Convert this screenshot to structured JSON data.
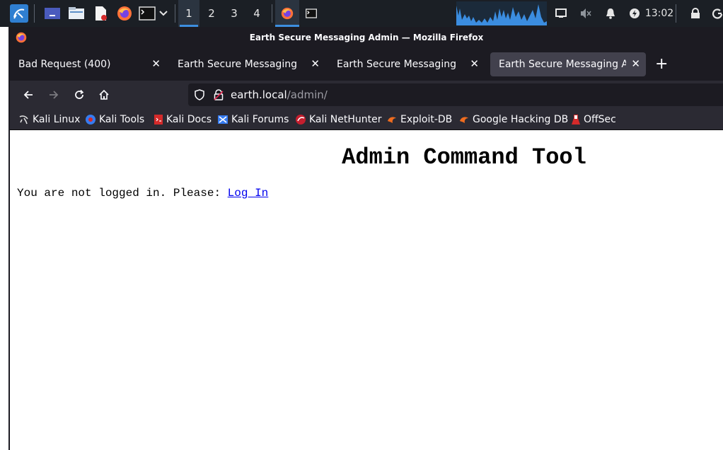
{
  "panel": {
    "workspaces": [
      "1",
      "2",
      "3",
      "4"
    ],
    "active_workspace": "1",
    "clock": "13:02",
    "icons": [
      "kali-menu-icon",
      "show-desktop-icon",
      "file-manager-icon",
      "text-editor-icon",
      "firefox-icon",
      "terminal-icon",
      "chevron-down-icon",
      "network-icon",
      "volume-muted-icon",
      "notification-bell-icon",
      "power-manager-icon",
      "lock-icon",
      "logout-icon"
    ]
  },
  "window": {
    "title": "Earth Secure Messaging Admin — Mozilla Firefox"
  },
  "tabs": [
    {
      "label": "Bad Request (400)",
      "active": false
    },
    {
      "label": "Earth Secure Messaging",
      "active": false
    },
    {
      "label": "Earth Secure Messaging",
      "active": false
    },
    {
      "label": "Earth Secure Messaging Admin",
      "active": true
    }
  ],
  "url": {
    "host": "earth.local",
    "path": "/admin/"
  },
  "bookmarks": [
    {
      "label": "Kali Linux",
      "icon": "kali-dragon-icon"
    },
    {
      "label": "Kali Tools",
      "icon": "kali-tools-icon"
    },
    {
      "label": "Kali Docs",
      "icon": "kali-docs-icon"
    },
    {
      "label": "Kali Forums",
      "icon": "kali-forums-icon"
    },
    {
      "label": "Kali NetHunter",
      "icon": "kali-nethunter-icon"
    },
    {
      "label": "Exploit-DB",
      "icon": "exploit-db-icon"
    },
    {
      "label": "Google Hacking DB",
      "icon": "ghdb-icon"
    },
    {
      "label": "OffSec",
      "icon": "offsec-icon"
    }
  ],
  "page": {
    "heading": "Admin Command Tool",
    "message": "You are not logged in. Please: ",
    "login_link": "Log In"
  },
  "colors": {
    "panel_bg": "#1b1f25",
    "accent": "#3d8fe0",
    "firefox_chrome": "#1c1b22",
    "toolbar": "#2b2a33",
    "link": "#0000ee"
  }
}
